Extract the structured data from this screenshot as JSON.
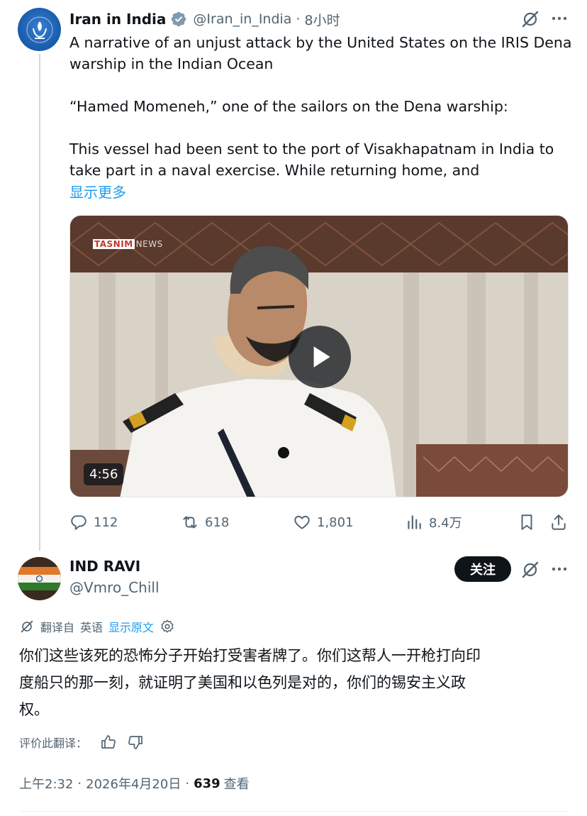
{
  "parent_tweet": {
    "author_name": "Iran in India",
    "handle": "@Iran_in_India",
    "separator": "·",
    "time": "8小时",
    "text_lines": [
      "A narrative of an unjust attack by the United States on the IRIS Dena",
      "warship in the Indian Ocean",
      "“Hamed Momeneh,” one of the sailors on the Dena warship:",
      "This vessel had been sent to the port of Visakhapatnam in India to",
      "take part in a naval exercise. While returning home, and"
    ],
    "show_more": "显示更多",
    "video": {
      "watermark_brand": "TASNIM",
      "watermark_suffix": "NEWS",
      "duration": "4:56"
    },
    "actions": {
      "replies": "112",
      "reposts": "618",
      "likes": "1,801",
      "views": "8.4万"
    },
    "icons": {
      "verified": "verified-badge-icon",
      "grok": "grok-icon",
      "more": "more-icon"
    }
  },
  "reply_tweet": {
    "author_name": "IND RAVI",
    "handle": "@Vmro_Chill",
    "follow_label": "关注",
    "translation": {
      "translated_from": "翻译自",
      "language": "英语",
      "show_original": "显示原文"
    },
    "text_lines": [
      "你们这些该死的恐怖分子开始打受害者牌了。你们这帮人一开枪打向印",
      "度船只的那一刻，就证明了美国和以色列是对的，你们的锡安主义政",
      "权。"
    ],
    "rate_label": "评价此翻译：",
    "timestamp": "上午2:32",
    "separator": "·",
    "date": "2026年4月20日",
    "views": "639",
    "views_label": "查看"
  },
  "colors": {
    "accent": "#1d9bf0",
    "text_primary": "#0f1419",
    "text_secondary": "#536471",
    "follow_bg": "#0f1419"
  }
}
